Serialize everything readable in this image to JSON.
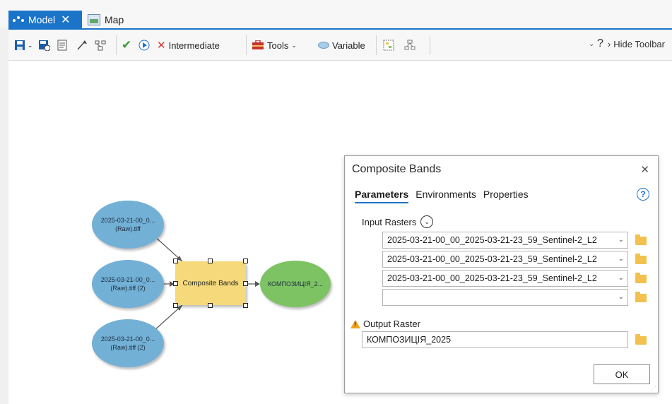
{
  "tabs": [
    {
      "label": "Model",
      "icon": "model-icon",
      "active": true
    },
    {
      "label": "Map",
      "icon": "map-icon",
      "active": false
    }
  ],
  "toolbar": {
    "intermediate_label": "Intermediate",
    "tools_label": "Tools",
    "variable_label": "Variable",
    "hide_toolbar_label": "Hide Toolbar"
  },
  "model": {
    "input1": [
      "2025-03-21-00_0...",
      "(Raw).tiff"
    ],
    "input2": [
      "2025-03-21-00_0...",
      "(Raw).tiff (2)"
    ],
    "input3": [
      "2025-03-21-00_0...",
      "(Raw).tiff (2)"
    ],
    "tool": "Composite Bands",
    "output": "КОМПОЗИЦІЯ_2..."
  },
  "dialog": {
    "title": "Composite Bands",
    "tabs": [
      "Parameters",
      "Environments",
      "Properties"
    ],
    "input_rasters_label": "Input Rasters",
    "inputs": [
      "2025-03-21-00_00_2025-03-21-23_59_Sentinel-2_L2",
      "2025-03-21-00_00_2025-03-21-23_59_Sentinel-2_L2",
      "2025-03-21-00_00_2025-03-21-23_59_Sentinel-2_L2",
      ""
    ],
    "output_raster_label": "Output Raster",
    "output_value": "КОМПОЗИЦІЯ_2025",
    "ok_label": "OK"
  },
  "colors": {
    "accent": "#1b74c8",
    "input_node": "#72b0d6",
    "tool_node": "#f5d97a",
    "output_node": "#7dc364"
  }
}
